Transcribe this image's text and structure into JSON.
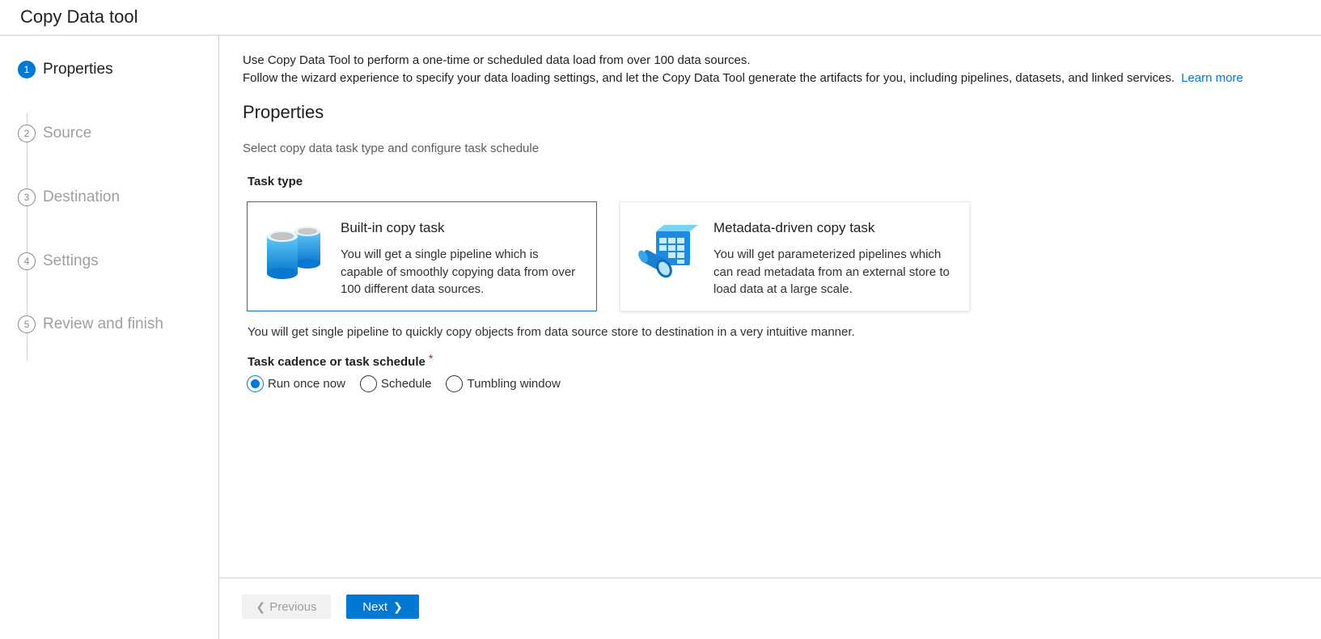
{
  "app": {
    "title": "Copy Data tool"
  },
  "steps": [
    {
      "num": "1",
      "label": "Properties",
      "state": "active"
    },
    {
      "num": "2",
      "label": "Source",
      "state": "inactive"
    },
    {
      "num": "3",
      "label": "Destination",
      "state": "inactive"
    },
    {
      "num": "4",
      "label": "Settings",
      "state": "inactive"
    },
    {
      "num": "5",
      "label": "Review and finish",
      "state": "inactive"
    }
  ],
  "intro": {
    "line1": "Use Copy Data Tool to perform a one-time or scheduled data load from over 100 data sources.",
    "line2": "Follow the wizard experience to specify your data loading settings, and let the Copy Data Tool generate the artifacts for you, including pipelines, datasets, and linked services.",
    "learn_more": "Learn more"
  },
  "properties": {
    "title": "Properties",
    "subtitle": "Select copy data task type and configure task schedule",
    "task_type_label": "Task type",
    "cards": [
      {
        "title": "Built-in copy task",
        "description": "You will get a single pipeline which is capable of smoothly copying data from over 100 different data sources.",
        "icon": "database-cylinders-icon",
        "selected": true
      },
      {
        "title": "Metadata-driven copy task",
        "description": "You will get parameterized pipelines which can read metadata from an external store to load data at a large scale.",
        "icon": "metadata-pipeline-icon",
        "selected": false
      }
    ],
    "hint": "You will get single pipeline to quickly copy objects from data source store to destination in a very intuitive manner.",
    "cadence_label": "Task cadence or task schedule",
    "required_mark": "*",
    "cadence_options": [
      {
        "label": "Run once now",
        "checked": true
      },
      {
        "label": "Schedule",
        "checked": false
      },
      {
        "label": "Tumbling window",
        "checked": false
      }
    ]
  },
  "footer": {
    "previous_label": "Previous",
    "next_label": "Next",
    "previous_icon": "chevron-left-icon",
    "next_icon": "chevron-right-icon"
  },
  "colors": {
    "accent": "#0078d4",
    "required": "#a4262c",
    "disabled_text": "#a19f9d",
    "border": "#d2d0ce"
  }
}
